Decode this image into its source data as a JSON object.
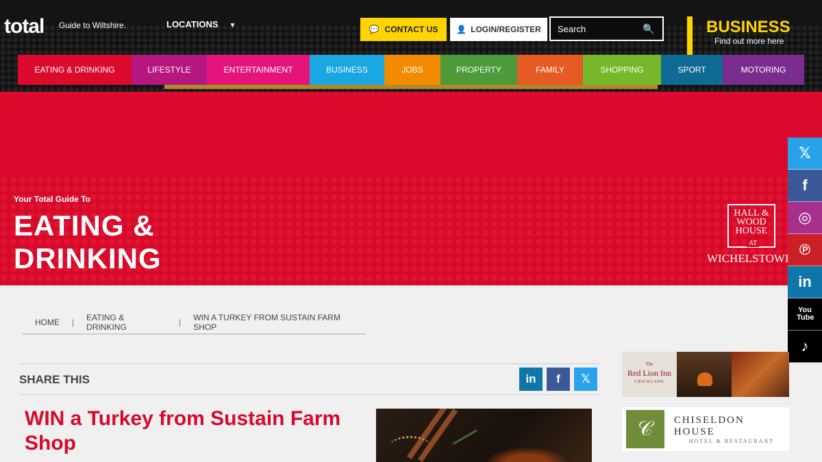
{
  "header": {
    "logo": "total",
    "logo_sub": "Guide to Wiltshire.",
    "locations": "LOCATIONS",
    "contact_label": "CONTACT US",
    "login_label": "LOGIN/REGISTER",
    "search_placeholder": "Search",
    "promo_title": "BUSINESS",
    "promo_sub": "Find out more here"
  },
  "nav": [
    {
      "label": "EATING & DRINKING",
      "color": "#dc0a2c"
    },
    {
      "label": "LIFESTYLE",
      "color": "#b5177e"
    },
    {
      "label": "ENTERTAINMENT",
      "color": "#e5147a"
    },
    {
      "label": "BUSINESS",
      "color": "#18a7e0"
    },
    {
      "label": "JOBS",
      "color": "#f28b00"
    },
    {
      "label": "PROPERTY",
      "color": "#4c9a3a"
    },
    {
      "label": "FAMILY",
      "color": "#e65a24"
    },
    {
      "label": "SHOPPING",
      "color": "#77b82a"
    },
    {
      "label": "SPORT",
      "color": "#0f6a96"
    },
    {
      "label": "MOTORING",
      "color": "#7b2d8f"
    }
  ],
  "hero": {
    "kicker": "Your Total Guide To",
    "title": "EATING & DRINKING",
    "sponsor_box": "HALL & WOOD HOUSE",
    "sponsor_at": "AT",
    "sponsor_name": "WICHELSTOWE"
  },
  "social": [
    {
      "icon": "x-icon",
      "glyph": "𝕏",
      "color": "#2aa2ea"
    },
    {
      "icon": "facebook-icon",
      "glyph": "f",
      "color": "#3b5998"
    },
    {
      "icon": "instagram-icon",
      "glyph": "◎",
      "color": "#a8308d"
    },
    {
      "icon": "pinterest-icon",
      "glyph": "℗",
      "color": "#cb2027"
    },
    {
      "icon": "linkedin-icon",
      "glyph": "in",
      "color": "#0e76a8"
    },
    {
      "icon": "youtube-icon",
      "glyph": "You Tube",
      "color": "#000000"
    },
    {
      "icon": "tiktok-icon",
      "glyph": "♪",
      "color": "#000000"
    }
  ],
  "breadcrumb": {
    "home": "HOME",
    "section": "EATING & DRINKING",
    "current": "WIN A TURKEY FROM SUSTAIN FARM SHOP",
    "sep": "|"
  },
  "share": {
    "label": "SHARE THIS",
    "linkedin": "in",
    "facebook": "f",
    "x": "𝕏"
  },
  "article": {
    "headline": "WIN a Turkey from Sustain Farm Shop"
  },
  "ads": {
    "red_lion_small": "The",
    "red_lion_name": "Red Lion Inn",
    "red_lion_place": "CRICKLADE",
    "chiseldon_name": "CHISELDON HOUSE",
    "chiseldon_sub": "HOTEL & RESTAURANT"
  }
}
